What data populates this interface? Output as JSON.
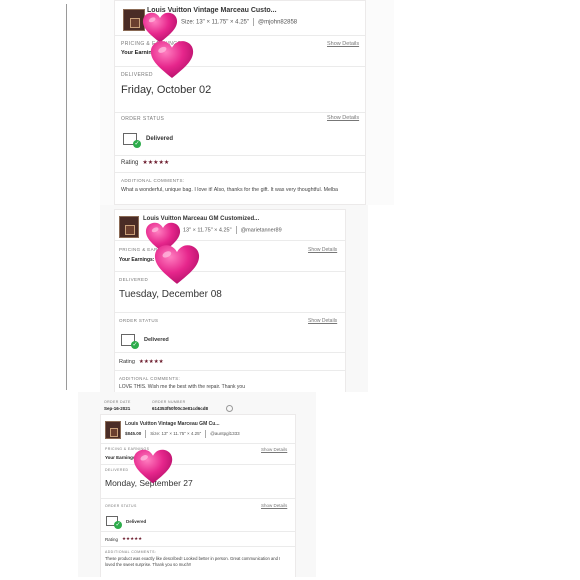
{
  "orders": [
    {
      "product_title": "Louis Vuitton Vintage Marceau Custo...",
      "size_text": "Size: 13\" × 11.75\" × 4.25\"",
      "buyer": "@mjohn82858",
      "pricing_label": "PRICING & EARNINGS",
      "earnings_label": "Your Earnings",
      "show_details_label": "Show Details",
      "delivered_label": "DELIVERED",
      "delivered_date": "Friday, October 02",
      "order_status_label": "ORDER STATUS",
      "status_value": "Delivered",
      "rating_label": "Rating",
      "rating_stars": "★★★★★",
      "rating_value": 5,
      "comments_label": "ADDITIONAL COMMENTS:",
      "comment": "What a wonderful, unique bag. I love it! Also, thanks for the gift. It was very thoughtful.  Melba"
    },
    {
      "product_title": "Louis Vuitton Marceau GM Customized...",
      "size_text": "13\" × 11.75\" × 4.25\"",
      "buyer": "@marietanner89",
      "pricing_label": "PRICING & EARNINGS",
      "earnings_label": "Your Earnings: $",
      "show_details_label": "Show Details",
      "delivered_label": "DELIVERED",
      "delivered_date": "Tuesday, December 08",
      "order_status_label": "ORDER STATUS",
      "status_value": "Delivered",
      "rating_label": "Rating",
      "rating_stars": "★★★★★",
      "rating_value": 5,
      "comments_label": "ADDITIONAL COMMENTS:",
      "comment": "LOVE THIS. Wish me the best with the repair. Thank you"
    },
    {
      "order_date_label": "ORDER DATE",
      "order_date": "Sep-16-2021",
      "order_number_label": "ORDER NUMBER",
      "order_number": "614353f50f00c3e81cd6cd8",
      "product_title": "Louis Vuitton Vintage Marceau GM Cu...",
      "price": "$845.00",
      "size_text": "Size: 13\" × 11.75\" × 4.25\"",
      "buyer": "@auntpgl1333",
      "pricing_label": "PRICING & EARNINGS",
      "earnings_label": "Your Earnings",
      "show_details_label": "Show Details",
      "delivered_label": "DELIVERED",
      "delivered_date": "Monday, September 27",
      "order_status_label": "ORDER STATUS",
      "status_value": "Delivered",
      "rating_label": "Rating",
      "rating_stars": "★★★★★",
      "rating_value": 5,
      "comments_label": "ADDITIONAL COMMENTS:",
      "comment": "These product was exactly like described! Looked better in person. Great communication and I loved the sweet surprise. Thank you so much!!"
    }
  ],
  "colors": {
    "heart": "#e6268c",
    "star": "#6b1b2c",
    "check": "#2dac4b"
  },
  "icons": [
    "heart-sticker",
    "package-delivered-icon",
    "star-icon",
    "copy-icon"
  ]
}
